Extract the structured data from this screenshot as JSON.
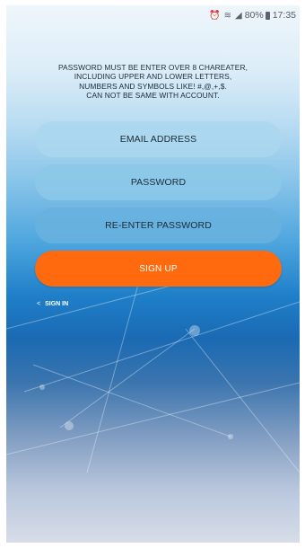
{
  "status_bar": {
    "battery_percent": "80%",
    "time": "17:35"
  },
  "notice": {
    "text": "PASSWORD MUST BE ENTER OVER 8 CHAREATER,\nINCLUDING UPPER AND LOWER LETTERS,\nNUMBERS AND SYMBOLS LIKE! #,@,+,$.\nCAN NOT BE SAME WITH ACCOUNT."
  },
  "form": {
    "email_placeholder": "EMAIL ADDRESS",
    "password_placeholder": "PASSWORD",
    "reenter_placeholder": "RE-ENTER PASSWORD",
    "signup_label": "SIGN UP"
  },
  "signin_link": {
    "chevron": "<",
    "label": "SIGN IN"
  },
  "colors": {
    "accent": "#ff6a0f",
    "background_top": "#eef6fb",
    "background_mid": "#1f7fc9",
    "background_bottom": "#d7dde8"
  }
}
